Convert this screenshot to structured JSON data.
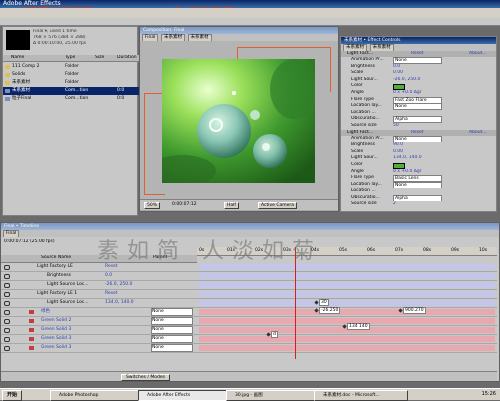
{
  "app_title": "Adobe After Effects",
  "watermark_top": "【我国打发旺网 YDFinfo.com】 搜集整理",
  "project": {
    "info_line1": "Final ▾, used 1 time",
    "info_line2": "768 × 576 (384 × 288)",
    "info_line3": "Δ 0:00:10:00, 25.00 fps",
    "columns": [
      "Name",
      "Type",
      "Size",
      "Duration"
    ],
    "items": [
      {
        "name": "111 Comp 2",
        "type": "Folder",
        "size": "",
        "dur": ""
      },
      {
        "name": "Solids",
        "type": "Folder",
        "size": "",
        "dur": ""
      },
      {
        "name": "未系素材",
        "type": "Folder",
        "size": "",
        "dur": ""
      },
      {
        "name": "未系素材",
        "type": "Com...tion",
        "size": "",
        "dur": "0:0"
      },
      {
        "name": "粒子Final",
        "type": "Com...tion",
        "size": "",
        "dur": "0:0"
      }
    ]
  },
  "composition": {
    "title": "Composition: Final",
    "tabs": [
      "Final",
      "未系素材",
      "未系素材"
    ],
    "zoom": "50%",
    "timecode": "0:00:07:12",
    "resolution": "Half",
    "view": "Active Camera"
  },
  "effects": {
    "title": "未系素材 • Effect Controls",
    "tabs": [
      "未系素材",
      "未系素材"
    ],
    "groups": [
      {
        "name": "Light Fact...",
        "reset": "Reset",
        "about": "About...",
        "rows": [
          {
            "k": "Animation Pr...",
            "v": "None"
          },
          {
            "k": "Brightness",
            "v": "0.0"
          },
          {
            "k": "Scale",
            "v": "0.00"
          },
          {
            "k": "Light Sour...",
            "v": "-26.0, 250.0"
          },
          {
            "k": "Color",
            "v": ""
          },
          {
            "k": "Angle",
            "v": "0 x +0.0 Δgr"
          },
          {
            "k": "Flare Type",
            "v": "Fast Zoo Flare"
          },
          {
            "k": "Location lay...",
            "v": "None"
          },
          {
            "k": "Location ...",
            "v": ""
          },
          {
            "k": "Obscuratio...",
            "v": "Alpha"
          },
          {
            "k": "Source size",
            "v": "50"
          }
        ]
      },
      {
        "name": "Light Fact...",
        "reset": "Reset",
        "about": "About...",
        "rows": [
          {
            "k": "Animation Pr...",
            "v": "None"
          },
          {
            "k": "Brightness",
            "v": "90.0"
          },
          {
            "k": "Scale",
            "v": "0.00"
          },
          {
            "k": "Light Sour...",
            "v": "134.0, 140.0"
          },
          {
            "k": "Color",
            "v": ""
          },
          {
            "k": "Angle",
            "v": "0 x +0.0 Δgr"
          },
          {
            "k": "Flare Type",
            "v": "Basic Lens"
          },
          {
            "k": "Location lay...",
            "v": "None"
          },
          {
            "k": "Location ...",
            "v": ""
          },
          {
            "k": "Obscuratio...",
            "v": "Alpha"
          },
          {
            "k": "Source size",
            "v": "2"
          }
        ]
      }
    ]
  },
  "timeline": {
    "title": "Final • Timeline",
    "tab": "Final",
    "timecode": "0:00:07:12",
    "fps": "(25.00 fps)",
    "ticks": [
      "0s",
      "01s",
      "02s",
      "03s",
      "04s",
      "05s",
      "06s",
      "07s",
      "08s",
      "09s",
      "10s"
    ],
    "header_cols": [
      "Source Name",
      "Parent"
    ],
    "layers": [
      {
        "label": "Light Factory LE",
        "cls": "",
        "parent": "Reset"
      },
      {
        "label": "Brightness",
        "cls": "",
        "parent": "0.0"
      },
      {
        "label": "Light Source Loc...",
        "cls": "",
        "parent": "-26.0, 250.0"
      },
      {
        "label": "Light Factory LE 1",
        "cls": "",
        "parent": "Reset"
      },
      {
        "label": "Light Source Loc...",
        "cls": "",
        "parent": "134.0, 140.0"
      },
      {
        "label": "绿色",
        "cls": "",
        "parent": "None"
      },
      {
        "label": "Green Solid 2",
        "cls": "",
        "parent": "None"
      },
      {
        "label": "Green Solid 3",
        "cls": "",
        "parent": "None"
      },
      {
        "label": "Green Solid 3",
        "cls": "",
        "parent": "None"
      },
      {
        "label": "Green Solid 3",
        "cls": "",
        "parent": "None"
      }
    ],
    "kf_labels": [
      "30",
      "-26.250",
      "900.270",
      "134 140",
      "d"
    ],
    "switches_label": "Switches / Modes",
    "watermark": "素如简 人淡如菊"
  },
  "taskbar": {
    "start": "开始",
    "items": [
      "Adobe Photoshop",
      "Adobe After Effects",
      "30.jpg - 画图",
      "未系素材.doc - Microsoft..."
    ],
    "clock": "15:26"
  },
  "colors": {
    "title_blue": "#0a246a",
    "accent_green": "#4caf3a",
    "pink": "#e8a8b0"
  }
}
